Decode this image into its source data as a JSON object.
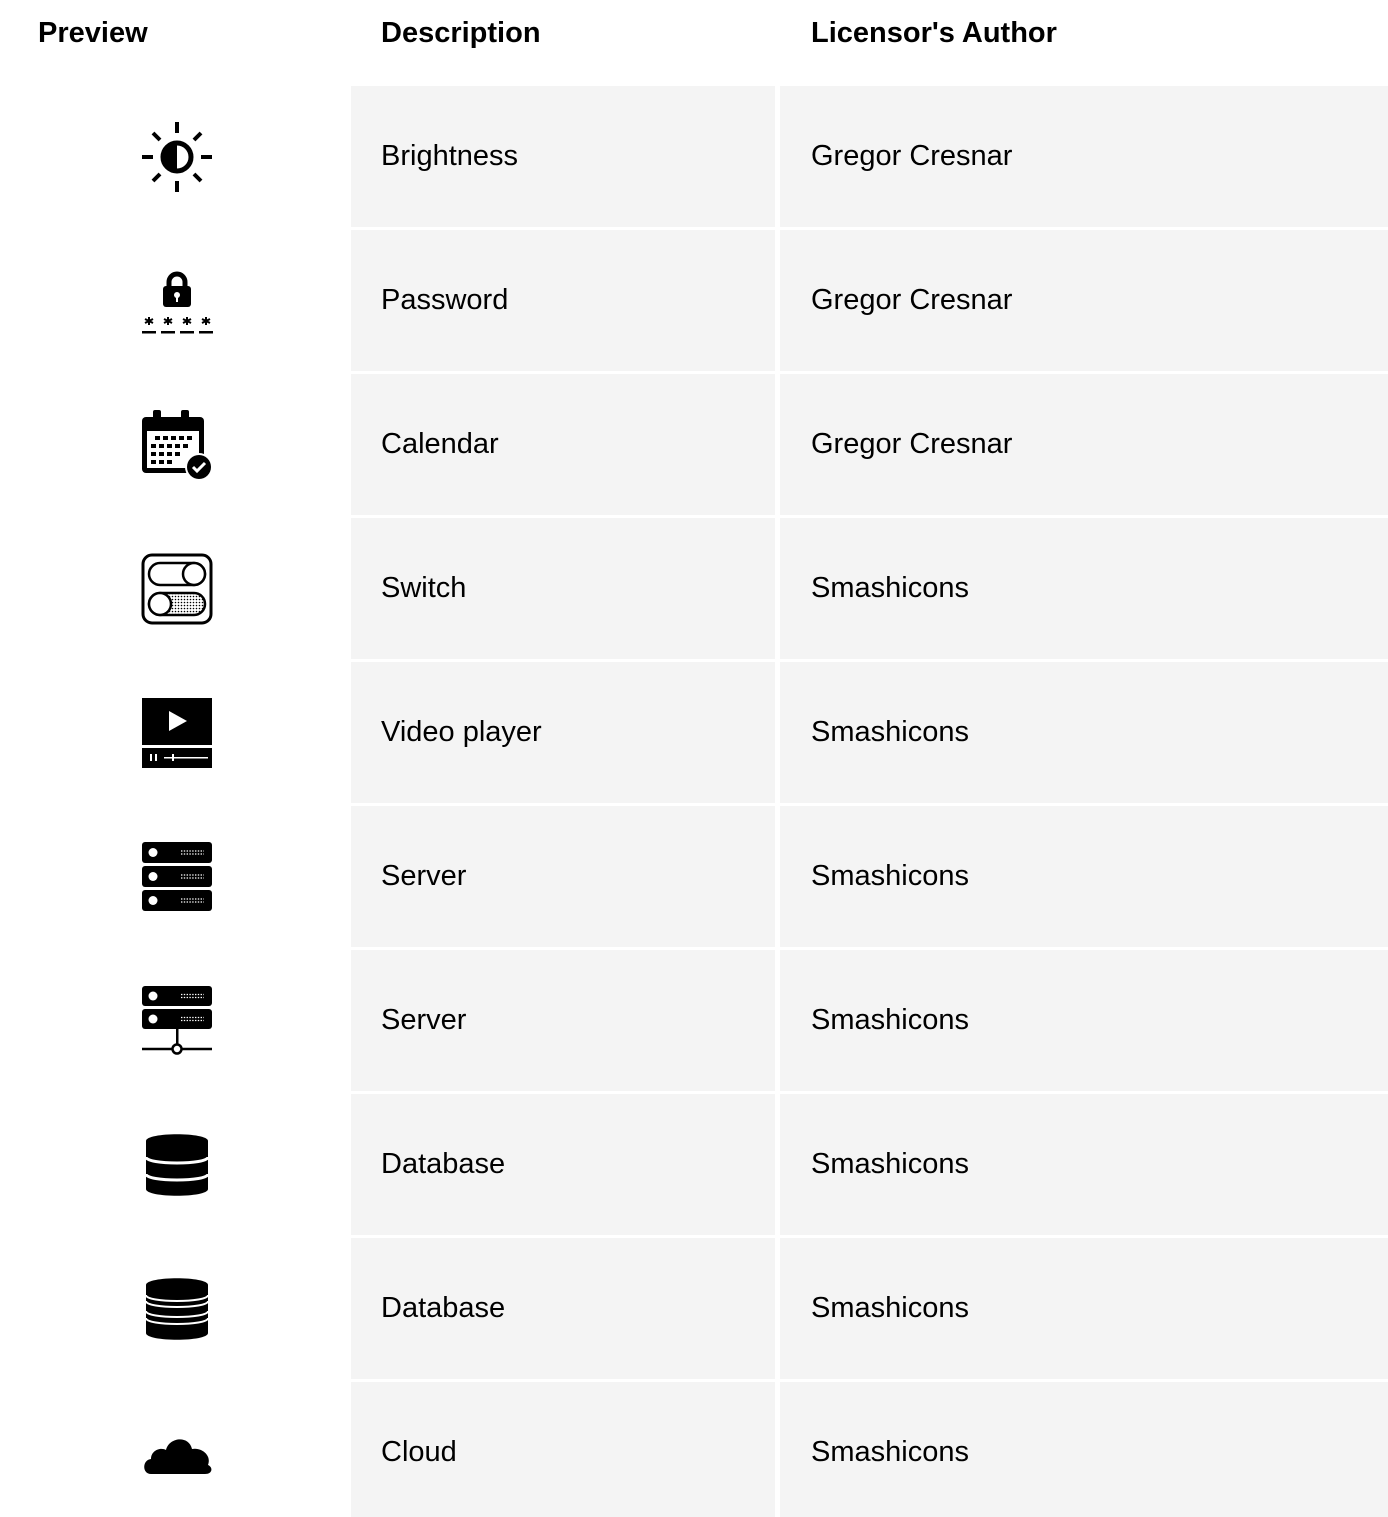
{
  "table": {
    "headers": {
      "preview": "Preview",
      "description": "Description",
      "author": "Licensor's Author"
    },
    "cell_background": "#f4f4f4",
    "rows": [
      {
        "icon": "brightness-icon",
        "description": "Brightness",
        "author": "Gregor Cresnar"
      },
      {
        "icon": "password-icon",
        "description": "Password",
        "author": "Gregor Cresnar"
      },
      {
        "icon": "calendar-icon",
        "description": "Calendar",
        "author": "Gregor Cresnar"
      },
      {
        "icon": "switch-icon",
        "description": "Switch",
        "author": "Smashicons"
      },
      {
        "icon": "video-player-icon",
        "description": "Video player",
        "author": "Smashicons"
      },
      {
        "icon": "server-icon",
        "description": "Server",
        "author": "Smashicons"
      },
      {
        "icon": "server-network-icon",
        "description": "Server",
        "author": "Smashicons"
      },
      {
        "icon": "database-icon",
        "description": "Database",
        "author": "Smashicons"
      },
      {
        "icon": "database-striped-icon",
        "description": "Database",
        "author": "Smashicons"
      },
      {
        "icon": "cloud-icon",
        "description": "Cloud",
        "author": "Smashicons"
      }
    ]
  }
}
